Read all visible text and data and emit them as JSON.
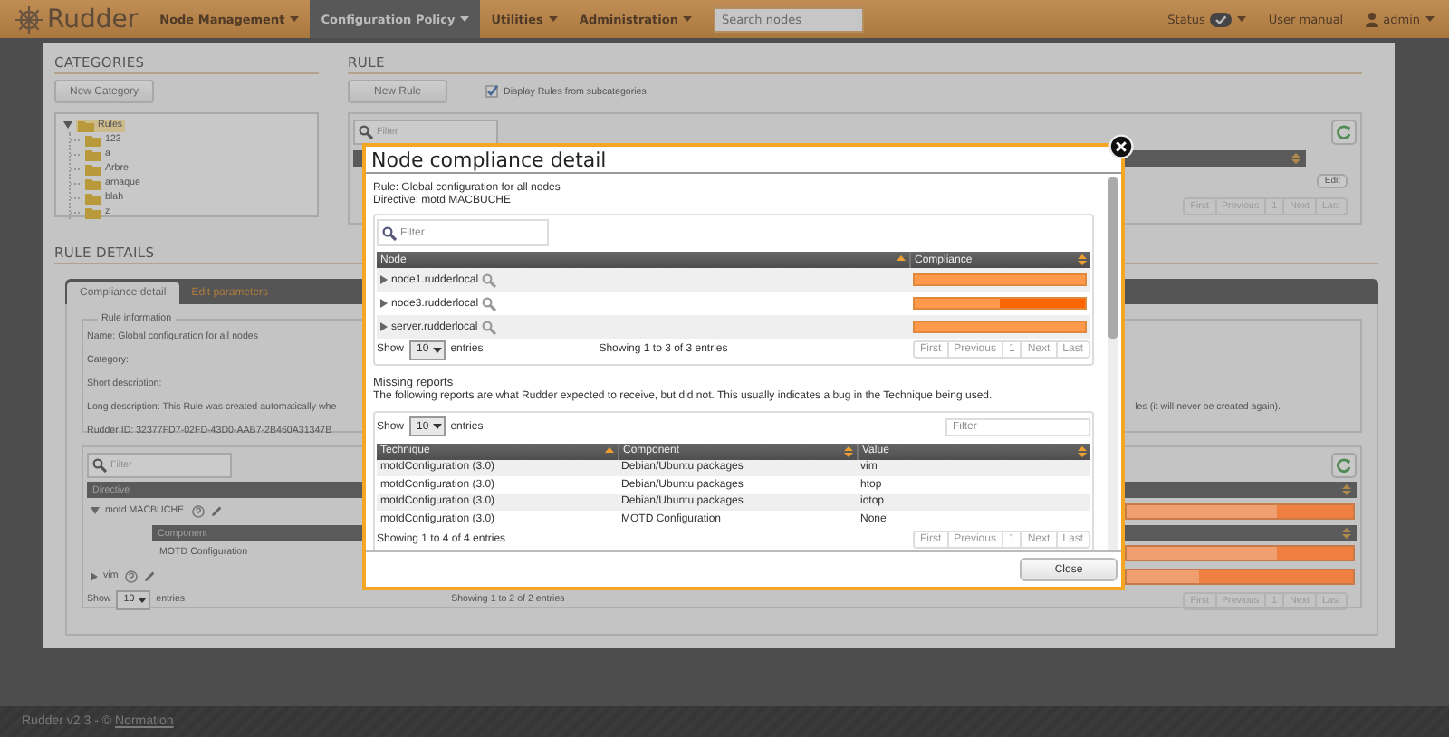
{
  "nav": {
    "logo": "Rudder",
    "menus": [
      {
        "label": "Node Management",
        "selected": false
      },
      {
        "label": "Configuration Policy",
        "selected": true
      },
      {
        "label": "Utilities",
        "selected": false
      },
      {
        "label": "Administration",
        "selected": false
      }
    ],
    "search": {
      "placeholder": "Search nodes"
    },
    "status": "Status",
    "user_manual": "User manual",
    "user": "admin"
  },
  "categories": {
    "title": "CATEGORIES",
    "new_button": "New Category",
    "tree": [
      {
        "label": "Rules",
        "expanded": true,
        "selected": true,
        "children": [
          {
            "label": "123",
            "selected": false
          },
          {
            "label": "a",
            "selected": false
          },
          {
            "label": "Arbre",
            "selected": false
          },
          {
            "label": "arnaque",
            "selected": false
          },
          {
            "label": "blah",
            "selected": false
          },
          {
            "label": "z",
            "selected": false
          }
        ]
      }
    ]
  },
  "rule": {
    "title": "RULE",
    "new_button": "New Rule",
    "subcategories": {
      "label": "Display Rules from subcategories",
      "checked": true
    },
    "filter": {
      "placeholder": "Filter"
    },
    "edit_button": "Edit",
    "pagination": [
      "First",
      "Previous",
      "1",
      "Next",
      "Last"
    ]
  },
  "rule_details": {
    "title": "RULE DETAILS",
    "tabs": [
      {
        "label": "Compliance detail",
        "selected": true
      },
      {
        "label": "Edit parameters",
        "selected": false
      }
    ],
    "info": {
      "legend": "Rule information",
      "lines": [
        "Name: Global configuration for all nodes",
        "Category:",
        "Short description:"
      ],
      "long_description": [
        "Long description: This Rule was created automatically whe",
        "les (it will never be created again)."
      ],
      "rudder_id": "Rudder ID: 32377FD7-02FD-43D0-AAB7-2B460A31347B"
    },
    "compliance": {
      "filter": {
        "placeholder": "Filter"
      },
      "column": "Directive",
      "directives": [
        {
          "name": "motd MACBUCHE",
          "expanded": true,
          "compliance": {
            "level": 0.66
          },
          "component_column": "Component",
          "components": [
            {
              "name": "MOTD Configuration",
              "compliance": {
                "level": 0.66
              }
            }
          ]
        },
        {
          "name": "vim",
          "expanded": false,
          "compliance": {
            "level": 0.32
          }
        }
      ],
      "show": {
        "before": "Show",
        "value": "10",
        "after": "entries"
      },
      "info": "Showing 1 to 2 of 2 entries",
      "pagination": [
        "First",
        "Previous",
        "1",
        "Next",
        "Last"
      ]
    }
  },
  "modal": {
    "title": "Node compliance detail",
    "rule": "Rule: Global configuration for all nodes",
    "directive": "Directive: motd MACBUCHE",
    "nodes": {
      "filter": {
        "placeholder": "Filter"
      },
      "columns": [
        {
          "label": "Node",
          "sorted": true
        },
        {
          "label": "Compliance",
          "sorted": false
        }
      ],
      "rows": [
        {
          "name": "node1.rudderlocal",
          "expanded": false,
          "compliance": {
            "level": 1
          }
        },
        {
          "name": "node3.rudderlocal",
          "expanded": false,
          "compliance": {
            "level": 0.5
          }
        },
        {
          "name": "server.rudderlocal",
          "expanded": false,
          "compliance": {
            "level": 1
          }
        }
      ],
      "show": {
        "before": "Show",
        "value": "10",
        "after": "entries"
      },
      "info": "Showing 1 to 3 of 3 entries",
      "pagination": [
        "First",
        "Previous",
        "1",
        "Next",
        "Last"
      ]
    },
    "missing": {
      "title": "Missing reports",
      "description": "The following reports are what Rudder expected to receive, but did not. This usually indicates a bug in the Technique being used.",
      "show": {
        "before": "Show",
        "value": "10",
        "after": "entries"
      },
      "filter": {
        "placeholder": "Filter"
      },
      "columns": [
        {
          "label": "Technique",
          "sorted": true
        },
        {
          "label": "Component",
          "sorted": false
        },
        {
          "label": "Value",
          "sorted": false
        }
      ],
      "rows": [
        [
          "motdConfiguration (3.0)",
          "Debian/Ubuntu packages",
          "vim"
        ],
        [
          "motdConfiguration (3.0)",
          "Debian/Ubuntu packages",
          "htop"
        ],
        [
          "motdConfiguration (3.0)",
          "Debian/Ubuntu packages",
          "iotop"
        ],
        [
          "motdConfiguration (3.0)",
          "MOTD Configuration",
          "None"
        ]
      ],
      "info": "Showing 1 to 4 of 4 entries",
      "pagination": [
        "First",
        "Previous",
        "1",
        "Next",
        "Last"
      ]
    },
    "close_button": "Close"
  },
  "footer": {
    "text": "Rudder v2.3 - ©",
    "link": "Normation"
  }
}
